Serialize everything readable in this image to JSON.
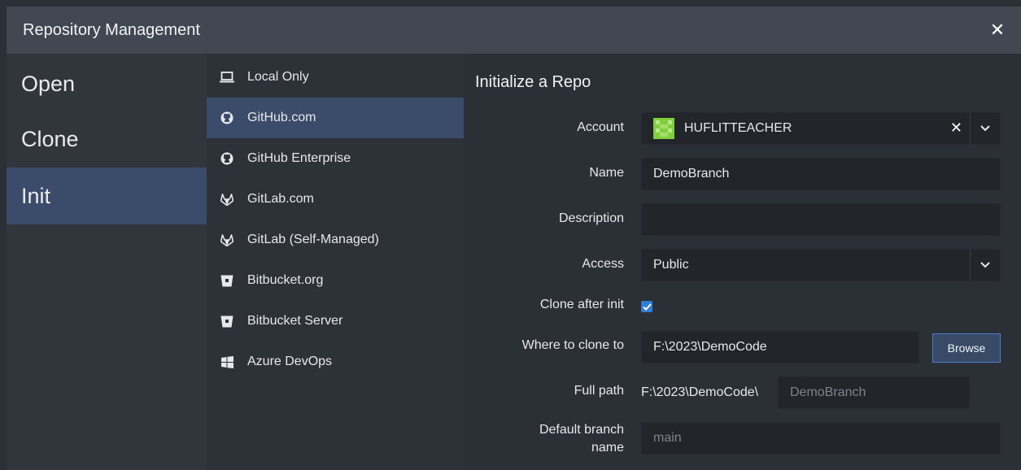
{
  "window": {
    "title": "Repository Management"
  },
  "left_nav": {
    "items": [
      {
        "label": "Open"
      },
      {
        "label": "Clone"
      },
      {
        "label": "Init"
      }
    ]
  },
  "providers": {
    "items": [
      {
        "label": "Local Only",
        "icon": "laptop-icon"
      },
      {
        "label": "GitHub.com",
        "icon": "github-icon"
      },
      {
        "label": "GitHub Enterprise",
        "icon": "github-icon"
      },
      {
        "label": "GitLab.com",
        "icon": "gitlab-icon"
      },
      {
        "label": "GitLab (Self-Managed)",
        "icon": "gitlab-icon"
      },
      {
        "label": "Bitbucket.org",
        "icon": "bitbucket-icon"
      },
      {
        "label": "Bitbucket Server",
        "icon": "bitbucket-icon"
      },
      {
        "label": "Azure DevOps",
        "icon": "windows-icon"
      }
    ]
  },
  "form": {
    "heading": "Initialize a Repo",
    "account": {
      "label": "Account",
      "value": "HUFLITTEACHER"
    },
    "name": {
      "label": "Name",
      "value": "DemoBranch"
    },
    "description": {
      "label": "Description",
      "value": ""
    },
    "access": {
      "label": "Access",
      "value": "Public"
    },
    "clone_after_init": {
      "label": "Clone after init",
      "checked": true
    },
    "where_to_clone": {
      "label": "Where to clone to",
      "value": "F:\\2023\\DemoCode",
      "browse_label": "Browse"
    },
    "full_path": {
      "label": "Full path",
      "prefix": "F:\\2023\\DemoCode\\",
      "placeholder": "DemoBranch"
    },
    "default_branch": {
      "label_line1": "Default branch",
      "label_line2": "name",
      "placeholder": "main"
    }
  },
  "colors": {
    "accent": "#3b4c6b",
    "checkbox": "#2f7fd6",
    "avatar": "#7fcf3f"
  }
}
